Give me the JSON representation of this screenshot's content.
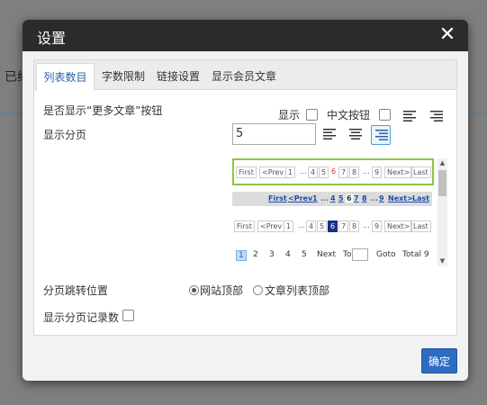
{
  "background": {
    "text": "已约"
  },
  "dialog": {
    "title": "设置",
    "close_icon": "close-icon",
    "tabs": [
      {
        "label": "列表数目",
        "active": true
      },
      {
        "label": "字数限制",
        "active": false
      },
      {
        "label": "链接设置",
        "active": false
      },
      {
        "label": "显示会员文章",
        "active": false
      }
    ],
    "show_more": {
      "label": "是否显示“更多文章”按钮",
      "show_label": "显示",
      "show_checked": false,
      "chinese_btn_label": "中文按钮",
      "chinese_btn_checked": false,
      "align_options": [
        "align-left-icon",
        "align-right-icon"
      ]
    },
    "pagination": {
      "label": "显示分页",
      "value": "5",
      "align_options": [
        "align-left-icon",
        "align-center-icon",
        "align-right-icon"
      ],
      "selected_align": "align-right-icon",
      "style1": {
        "items": [
          "First",
          "<Prev",
          "1",
          "...",
          "4",
          "5",
          "6",
          "7",
          "8",
          "...",
          "9",
          "Next>",
          "Last"
        ],
        "current": "6"
      },
      "style2": {
        "items": [
          "First",
          "<Prev",
          "1",
          "...",
          "4",
          "5",
          "6",
          "7",
          "8",
          "...",
          "9",
          "Next>",
          "Last"
        ],
        "current": "6"
      },
      "style3": {
        "items": [
          "First",
          "<Prev",
          "1",
          "...",
          "4",
          "5",
          "6",
          "7",
          "8",
          "...",
          "9",
          "Next>",
          "Last"
        ],
        "current": "6"
      },
      "style4": {
        "items": [
          "1",
          "2",
          "3",
          "4",
          "5",
          "Next",
          "To",
          "Goto",
          "Total 9"
        ],
        "current": "1"
      }
    },
    "jump_position": {
      "label": "分页跳转位置",
      "options": [
        {
          "label": "网站顶部",
          "selected": true
        },
        {
          "label": "文章列表顶部",
          "selected": false
        }
      ]
    },
    "show_record_count": {
      "label": "显示分页记录数",
      "checked": false
    },
    "ok_label": "确定"
  }
}
